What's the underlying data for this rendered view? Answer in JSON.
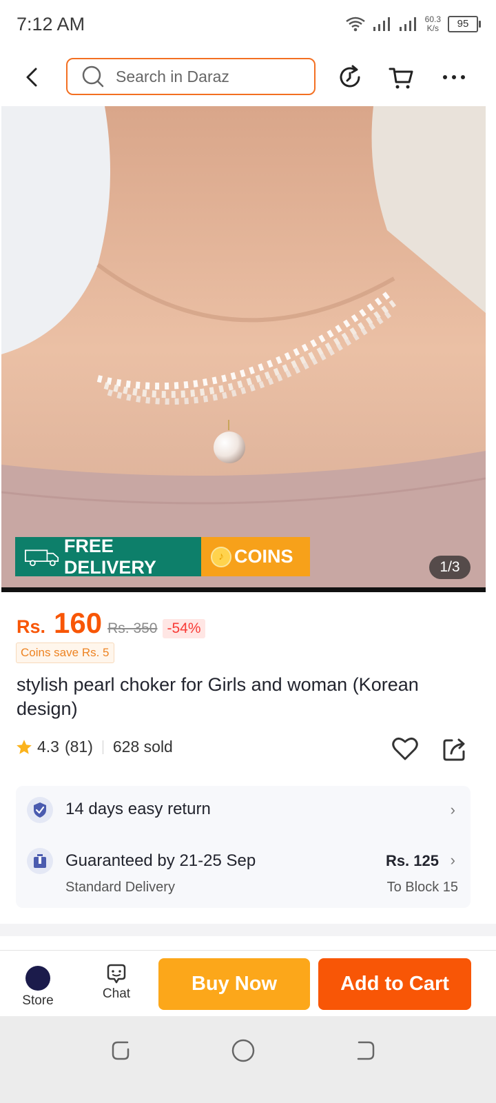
{
  "status_bar": {
    "time": "7:12 AM",
    "net_speed_value": "60.3",
    "net_speed_unit": "K/s",
    "battery": "95"
  },
  "header": {
    "search_placeholder": "Search in Daraz",
    "accent_color": "#f36f21"
  },
  "gallery": {
    "promo_free_delivery": "FREE DELIVERY",
    "promo_coins": "COINS",
    "truck_badge": "FREE",
    "counter": "1/3"
  },
  "product": {
    "currency": "Rs.",
    "price": "160",
    "original_price": "Rs. 350",
    "discount": "-54%",
    "coins_save": "Coins save Rs. 5",
    "title": "stylish pearl choker for Girls and woman (Korean design)",
    "rating": "4.3",
    "rating_count": "(81)",
    "sold": "628 sold",
    "price_color": "#f85606"
  },
  "services": {
    "return_text": "14 days easy return",
    "delivery_text": "Guaranteed by 21-25 Sep",
    "delivery_type": "Standard Delivery",
    "delivery_fee": "Rs. 125",
    "delivery_destination": "To Block 15"
  },
  "actions": {
    "store_label": "Store",
    "chat_label": "Chat",
    "buy_now": "Buy Now",
    "add_to_cart": "Add to Cart",
    "buy_now_color": "#fca71a",
    "add_to_cart_color": "#f85606"
  },
  "icons": {
    "back": "back-arrow-icon",
    "search": "search-icon",
    "history": "refresh-history-icon",
    "cart": "cart-icon",
    "more": "more-options-icon",
    "wishlist": "heart-icon",
    "share": "share-icon",
    "return": "shield-check-icon",
    "delivery": "delivery-box-icon"
  }
}
